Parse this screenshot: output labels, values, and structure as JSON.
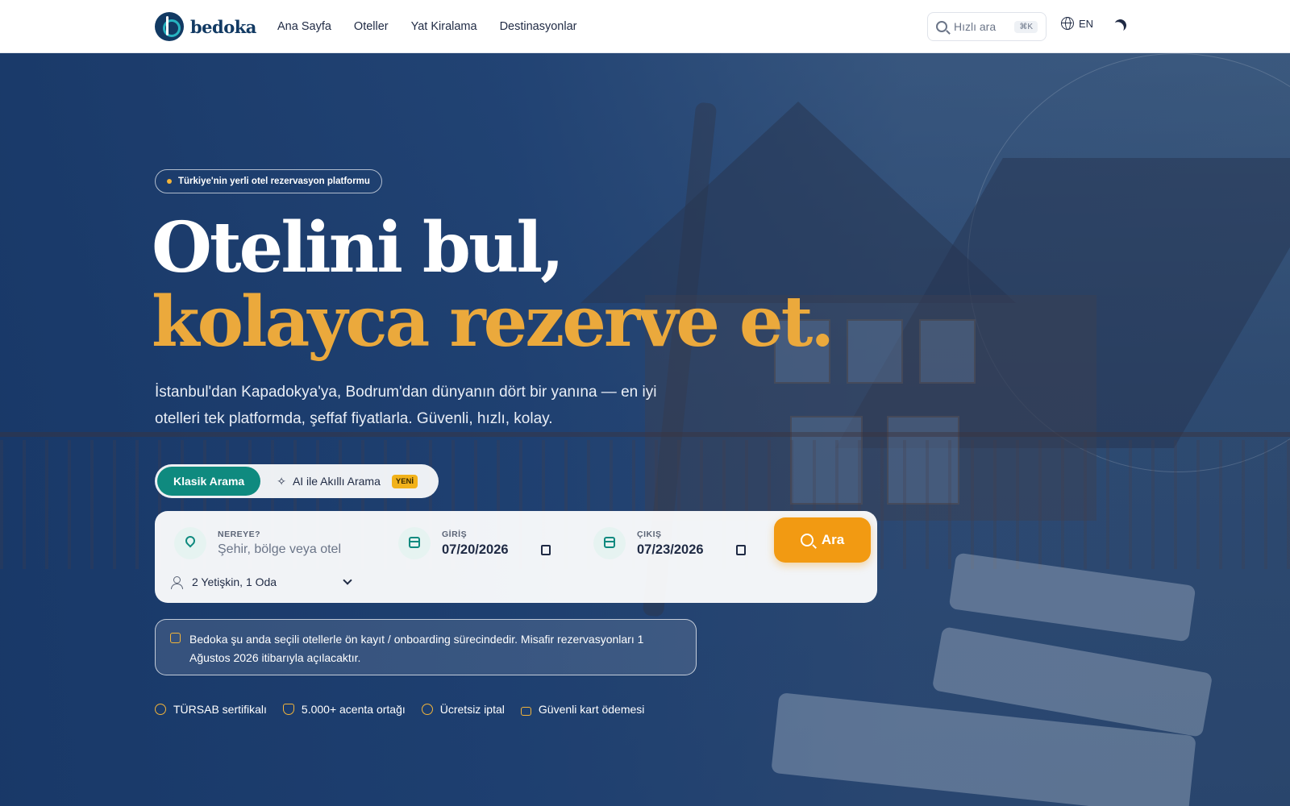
{
  "nav": {
    "logo_text": "bedoka",
    "links": [
      "Ana Sayfa",
      "Oteller",
      "Yat Kiralama",
      "Destinasyonlar"
    ],
    "search_placeholder": "Hızlı ara",
    "search_shortcut": "⌘K",
    "language": "EN"
  },
  "hero": {
    "badge": "Türkiye'nin yerli otel rezervasyon platformu",
    "title_line1": "Otelini bul,",
    "title_line2": "kolayca rezerve et.",
    "subtitle": "İstanbul'dan Kapadokya'ya, Bodrum'dan dünyanın dört bir yanına — en iyi otelleri tek platformda, şeffaf fiyatlarla. Güvenli, hızlı, kolay."
  },
  "search_tabs": {
    "classic": "Klasik Arama",
    "ai": "AI ile Akıllı Arama",
    "new_badge": "YENİ"
  },
  "search_form": {
    "where_label": "NEREYE?",
    "where_placeholder": "Şehir, bölge veya otel",
    "checkin_label": "GİRİŞ",
    "checkin_value": "07/20/2026",
    "checkout_label": "ÇIKIŞ",
    "checkout_value": "07/23/2026",
    "submit": "Ara",
    "guests": "2 Yetişkin, 1 Oda"
  },
  "notice": "Bedoka şu anda seçili otellerle ön kayıt / onboarding sürecindedir. Misafir rezervasyonları 1 Ağustos 2026 itibarıyla açılacaktır.",
  "trust": [
    "TÜRSAB sertifikalı",
    "5.000+ acenta ortağı",
    "Ücretsiz iptal",
    "Güvenli kart ödemesi"
  ],
  "colors": {
    "teal": "#0f8a7f",
    "orange": "#f29a12",
    "gold": "#eba93c",
    "navy": "#123a63"
  }
}
